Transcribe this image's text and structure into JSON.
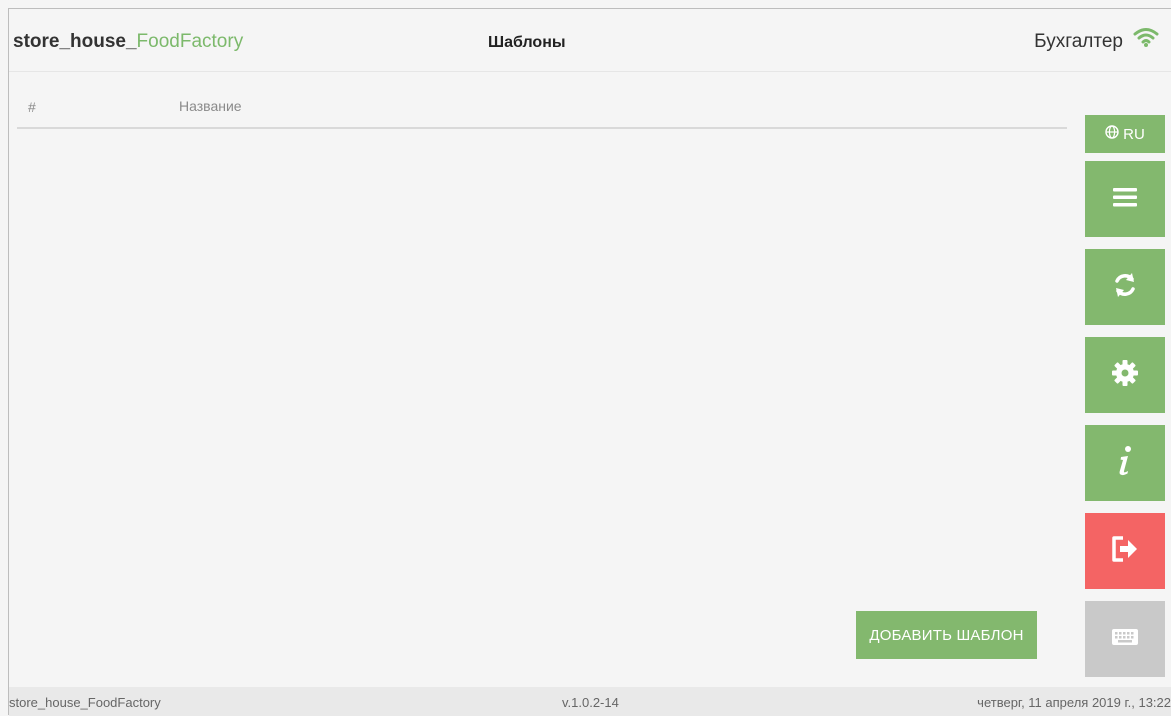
{
  "header": {
    "brand_prefix": "store_house_",
    "brand_accent": "FoodFactory",
    "title": "Шаблоны",
    "user": "Бухгалтер",
    "wifi_icon": "wifi-icon"
  },
  "table": {
    "columns": [
      "#",
      "Название"
    ],
    "rows": []
  },
  "sidebar": {
    "lang_label": "RU",
    "lang_icon": "globe-icon",
    "buttons": [
      {
        "name": "menu",
        "icon": "hamburger-icon",
        "color": "#83b86e"
      },
      {
        "name": "sync",
        "icon": "sync-icon",
        "color": "#83b86e"
      },
      {
        "name": "settings",
        "icon": "gear-icon",
        "color": "#83b86e"
      },
      {
        "name": "info",
        "icon": "info-icon",
        "color": "#83b86e"
      },
      {
        "name": "logout",
        "icon": "sign-out-icon",
        "color": "#f46464"
      },
      {
        "name": "keyboard",
        "icon": "keyboard-icon",
        "color": "#c9c9c9"
      }
    ]
  },
  "actions": {
    "add_template_label": "ДОБАВИТЬ ШАБЛОН"
  },
  "footer": {
    "app_name": "store_house_FoodFactory",
    "version": "v.1.0.2-14",
    "datetime": "четверг, 11 апреля 2019 г., 13:22"
  },
  "colors": {
    "accent": "#83b86e",
    "danger": "#f46464",
    "disabled": "#c9c9c9"
  }
}
